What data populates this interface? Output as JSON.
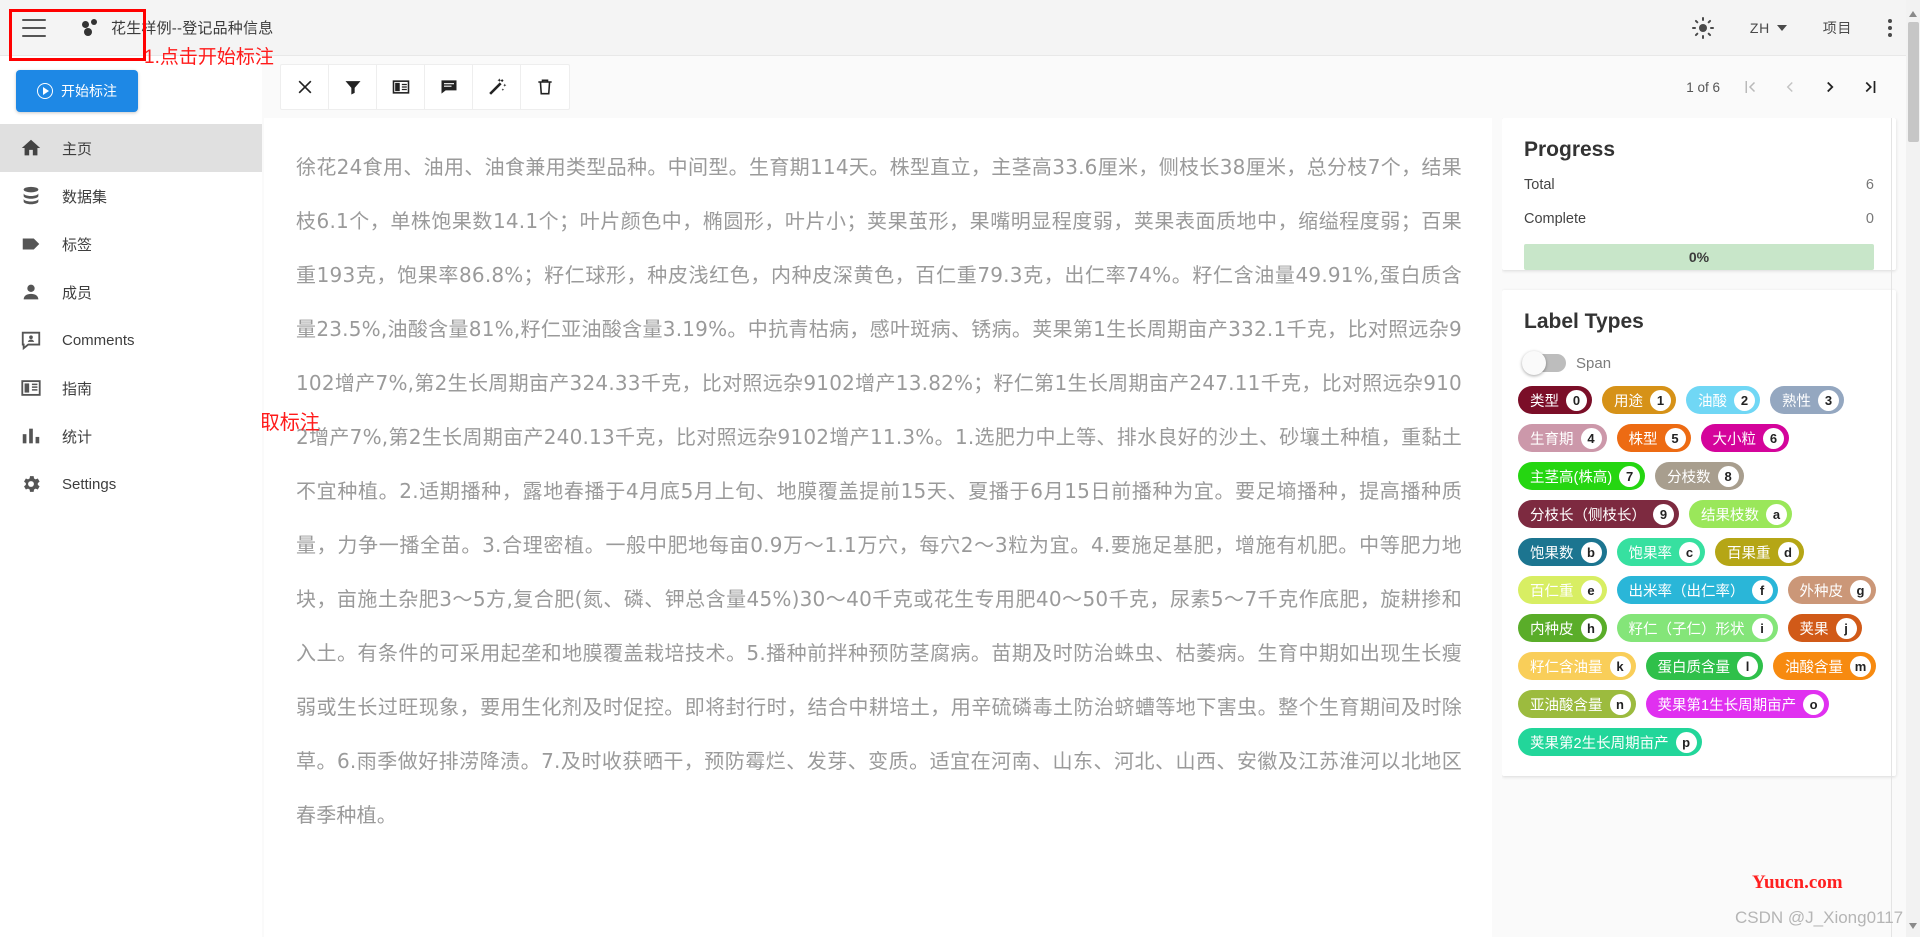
{
  "header": {
    "menu_icon": "hamburger-menu-icon",
    "logo_icon": "doccano-logo-icon",
    "project_title": "花生样例--登记品种信息",
    "theme_icon": "sun-icon",
    "language": "ZH",
    "projects_label": "项目",
    "overflow_icon": "kebab-menu-icon"
  },
  "sidebar": {
    "start_button": "开始标注",
    "start_icon": "play-circle-icon",
    "items": [
      {
        "label": "主页",
        "icon": "home-icon",
        "active": true
      },
      {
        "label": "数据集",
        "icon": "database-icon",
        "active": false
      },
      {
        "label": "标签",
        "icon": "tag-icon",
        "active": false
      },
      {
        "label": "成员",
        "icon": "person-icon",
        "active": false
      },
      {
        "label": "Comments",
        "icon": "comment-person-icon",
        "active": false
      },
      {
        "label": "指南",
        "icon": "book-icon",
        "active": false
      },
      {
        "label": "统计",
        "icon": "bar-chart-icon",
        "active": false
      },
      {
        "label": "Settings",
        "icon": "gear-icon",
        "active": false
      }
    ]
  },
  "annotations": {
    "step1": "1.点击开始标注",
    "span_note": "Span为实体抽取标注"
  },
  "toolbar": {
    "buttons": [
      {
        "name": "clear-annotations",
        "icon": "close-x-icon"
      },
      {
        "name": "filter",
        "icon": "funnel-icon"
      },
      {
        "name": "guideline",
        "icon": "book-open-icon"
      },
      {
        "name": "comment",
        "icon": "comment-icon"
      },
      {
        "name": "auto-label",
        "icon": "magic-wand-icon"
      },
      {
        "name": "delete",
        "icon": "trash-icon"
      }
    ]
  },
  "pager": {
    "text": "1 of 6",
    "first_icon": "first-page-icon",
    "prev_icon": "chevron-left-icon",
    "next_icon": "chevron-right-icon",
    "last_icon": "last-page-icon"
  },
  "document": {
    "text": "徐花24食用、油用、油食兼用类型品种。中间型。生育期114天。株型直立，主茎高33.6厘米，侧枝长38厘米，总分枝7个，结果枝6.1个，单株饱果数14.1个；叶片颜色中，椭圆形，叶片小；荚果茧形，果嘴明显程度弱，荚果表面质地中，缩缢程度弱；百果重193克，饱果率86.8%；籽仁球形，种皮浅红色，内种皮深黄色，百仁重79.3克，出仁率74%。籽仁含油量49.91%,蛋白质含量23.5%,油酸含量81%,籽仁亚油酸含量3.19%。中抗青枯病，感叶斑病、锈病。荚果第1生长周期亩产332.1千克，比对照远杂9102增产7%,第2生长周期亩产324.33千克，比对照远杂9102增产13.82%；籽仁第1生长周期亩产247.11千克，比对照远杂9102增产7%,第2生长周期亩产240.13千克，比对照远杂9102增产11.3%。1.选肥力中上等、排水良好的沙土、砂壤土种植，重黏土不宜种植。2.适期播种，露地春播于4月底5月上旬、地膜覆盖提前15天、夏播于6月15日前播种为宜。要足墒播种，提高播种质量，力争一播全苗。3.合理密植。一般中肥地每亩0.9万〜1.1万穴，每穴2〜3粒为宜。4.要施足基肥，增施有机肥。中等肥力地块，亩施土杂肥3〜5方,复合肥(氮、磷、钾总含量45%)30〜40千克或花生专用肥40〜50千克，尿素5〜7千克作底肥，旋耕掺和入土。有条件的可采用起垄和地膜覆盖栽培技术。5.播种前拌种预防茎腐病。苗期及时防治蛛虫、枯萎病。生育中期如出现生长瘦弱或生长过旺现象，要用生化剂及时促控。即将封行时，结合中耕培土，用辛硫磷毒土防治蛴螬等地下害虫。整个生育期间及时除草。6.雨季做好排涝降渍。7.及时收获晒干，预防霉烂、发芽、变质。适宜在河南、山东、河北、山西、安徽及江苏淮河以北地区春季种植。"
  },
  "progress": {
    "title": "Progress",
    "total_label": "Total",
    "total_value": "6",
    "complete_label": "Complete",
    "complete_value": "0",
    "percent_label": "0%",
    "bar_color": "#c8e6c9"
  },
  "label_types": {
    "title": "Label Types",
    "span_toggle_label": "Span",
    "span_toggle_on": false,
    "chips": [
      {
        "label": "类型",
        "key": "0",
        "bg": "#7b0e28",
        "fg": "#ffffff"
      },
      {
        "label": "用途",
        "key": "1",
        "bg": "#d69218",
        "fg": "#ffffff"
      },
      {
        "label": "油酸",
        "key": "2",
        "bg": "#70d7f5",
        "fg": "#ffffff"
      },
      {
        "label": "熟性",
        "key": "3",
        "bg": "#94a7c0",
        "fg": "#ffffff"
      },
      {
        "label": "生育期",
        "key": "4",
        "bg": "#cc98aa",
        "fg": "#ffffff"
      },
      {
        "label": "株型",
        "key": "5",
        "bg": "#ed6b13",
        "fg": "#ffffff"
      },
      {
        "label": "大小粒",
        "key": "6",
        "bg": "#d4049b",
        "fg": "#ffffff"
      },
      {
        "label": "主茎高(株高)",
        "key": "7",
        "bg": "#25d611",
        "fg": "#ffffff"
      },
      {
        "label": "分枝数",
        "key": "8",
        "bg": "#a89e8e",
        "fg": "#ffffff"
      },
      {
        "label": "分枝长（侧枝长）",
        "key": "9",
        "bg": "#7d2a40",
        "fg": "#ffffff"
      },
      {
        "label": "结果枝数",
        "key": "a",
        "bg": "#9ae75a",
        "fg": "#ffffff"
      },
      {
        "label": "饱果数",
        "key": "b",
        "bg": "#1c7590",
        "fg": "#ffffff"
      },
      {
        "label": "饱果率",
        "key": "c",
        "bg": "#37e0a0",
        "fg": "#ffffff"
      },
      {
        "label": "百果重",
        "key": "d",
        "bg": "#b5a616",
        "fg": "#ffffff"
      },
      {
        "label": "百仁重",
        "key": "e",
        "bg": "#d8ee63",
        "fg": "#ffffff"
      },
      {
        "label": "出米率（出仁率）",
        "key": "f",
        "bg": "#2ab6d8",
        "fg": "#ffffff"
      },
      {
        "label": "外种皮",
        "key": "g",
        "bg": "#cb9778",
        "fg": "#ffffff"
      },
      {
        "label": "内种皮",
        "key": "h",
        "bg": "#5aad29",
        "fg": "#ffffff"
      },
      {
        "label": "籽仁（子仁）形状",
        "key": "i",
        "bg": "#84e579",
        "fg": "#ffffff"
      },
      {
        "label": "荚果",
        "key": "j",
        "bg": "#d15a18",
        "fg": "#ffffff"
      },
      {
        "label": "籽仁含油量",
        "key": "k",
        "bg": "#f9ce59",
        "fg": "#ffffff"
      },
      {
        "label": "蛋白质含量",
        "key": "l",
        "bg": "#2fc04a",
        "fg": "#ffffff"
      },
      {
        "label": "油酸含量",
        "key": "m",
        "bg": "#f78a10",
        "fg": "#ffffff"
      },
      {
        "label": "亚油酸含量",
        "key": "n",
        "bg": "#9cbb3e",
        "fg": "#ffffff"
      },
      {
        "label": "荚果第1生长周期亩产",
        "key": "o",
        "bg": "#e030f0",
        "fg": "#ffffff"
      },
      {
        "label": "荚果第2生长周期亩产",
        "key": "p",
        "bg": "#22d69a",
        "fg": "#ffffff"
      }
    ]
  },
  "watermarks": {
    "red": "Yuucn.com",
    "grey": "CSDN @J_Xiong0117"
  }
}
